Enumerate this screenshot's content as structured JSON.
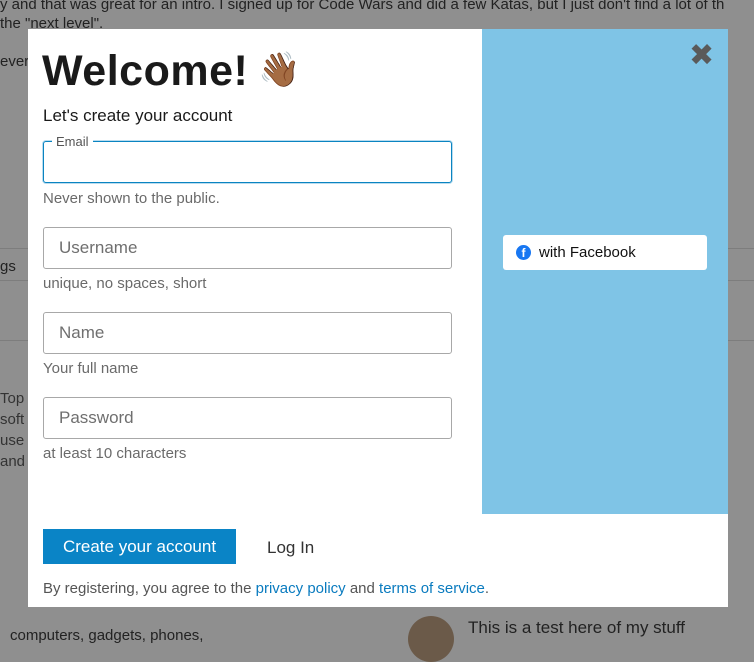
{
  "background": {
    "line1": "y and that was great for an intro. I signed up for Code Wars and did a few Katas, but I just don't find a lot of th",
    "line2": "the \"next level\".",
    "line3": "ever",
    "tags_fragment": "gs",
    "left_fragments": [
      "Top",
      "soft",
      "use",
      "and"
    ],
    "bottom_text": "computers, gadgets, phones,",
    "post_text": "This is a test here of my stuff"
  },
  "modal": {
    "title": "Welcome!",
    "title_emoji": "👋🏾",
    "subtitle": "Let's create your account",
    "close_icon": "close-icon",
    "fields": {
      "email": {
        "label": "Email",
        "value": "",
        "hint": "Never shown to the public."
      },
      "username": {
        "placeholder": "Username",
        "value": "",
        "hint": "unique, no spaces, short"
      },
      "name": {
        "placeholder": "Name",
        "value": "",
        "hint": "Your full name"
      },
      "password": {
        "placeholder": "Password",
        "value": "",
        "hint": "at least 10 characters"
      }
    },
    "facebook": {
      "label": "with Facebook",
      "icon": "facebook-icon",
      "color": "#1877f2"
    },
    "create_button": "Create your account",
    "login_link": "Log In",
    "legal": {
      "prefix": "By registering, you agree to the",
      "privacy": "privacy policy",
      "and": "and",
      "terms": "terms of service",
      "suffix": "."
    },
    "colors": {
      "accent": "#0a84c6",
      "side_panel": "#7fc4e6"
    }
  }
}
